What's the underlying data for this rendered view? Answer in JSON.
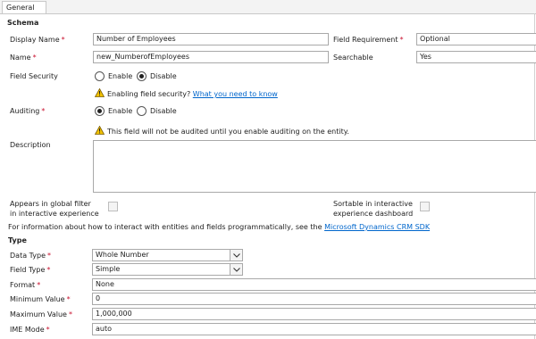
{
  "tabs": [
    "General"
  ],
  "schema": {
    "heading": "Schema",
    "display_name": {
      "label": "Display Name",
      "value": "Number of Employees"
    },
    "name": {
      "label": "Name",
      "value": "new_NumberofEmployees"
    },
    "field_requirement": {
      "label": "Field Requirement",
      "value": "Optional"
    },
    "searchable": {
      "label": "Searchable",
      "value": "Yes"
    },
    "field_security": {
      "label": "Field Security",
      "options": [
        "Enable",
        "Disable"
      ],
      "selected": "Disable",
      "notice_text": "Enabling field security?",
      "notice_link": "What you need to know"
    },
    "auditing": {
      "label": "Auditing",
      "options": [
        "Enable",
        "Disable"
      ],
      "selected": "Enable",
      "notice_text": "This field will not be audited until you enable auditing on the entity."
    },
    "description": {
      "label": "Description",
      "value": ""
    },
    "global_filter": {
      "label_line1": "Appears in global filter",
      "label_line2": "in interactive experience"
    },
    "sortable": {
      "label_line1": "Sortable in interactive",
      "label_line2": "experience dashboard"
    },
    "sdk_text": "For information about how to interact with entities and fields programmatically, see the",
    "sdk_link": "Microsoft Dynamics CRM SDK"
  },
  "type": {
    "heading": "Type",
    "data_type": {
      "label": "Data Type",
      "value": "Whole Number"
    },
    "field_type": {
      "label": "Field Type",
      "value": "Simple"
    },
    "format": {
      "label": "Format",
      "value": "None"
    },
    "min_value": {
      "label": "Minimum Value",
      "value": "0"
    },
    "max_value": {
      "label": "Maximum Value",
      "value": "1,000,000"
    },
    "ime_mode": {
      "label": "IME Mode",
      "value": "auto"
    }
  },
  "colors": {
    "required": "#c8102e",
    "link": "#0066cc",
    "warning": "#f2c200"
  }
}
